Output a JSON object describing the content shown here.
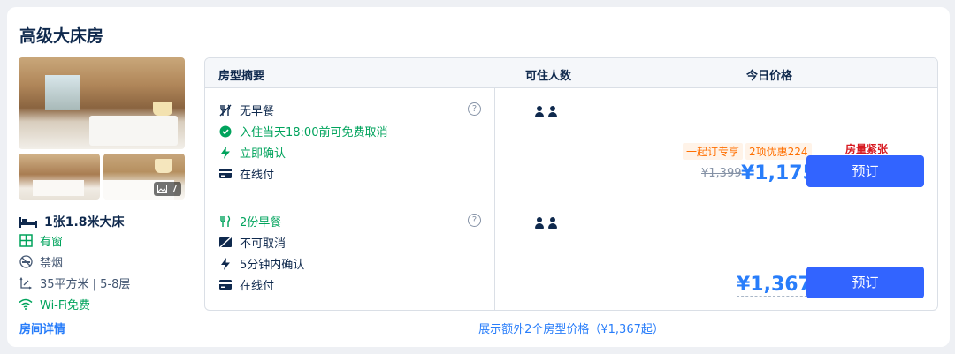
{
  "room": {
    "title": "高级大床房",
    "photo_count": "7",
    "bed": "1张1.8米大床",
    "features": [
      {
        "icon": "window-icon",
        "text": "有窗"
      },
      {
        "icon": "no-smoking-icon",
        "text": "禁烟"
      },
      {
        "icon": "area-icon",
        "text": "35平方米 | 5-8层"
      },
      {
        "icon": "wifi-icon",
        "text": "Wi-Fi免费"
      }
    ],
    "detail_link": "房间详情"
  },
  "table": {
    "headers": [
      "房型摘要",
      "可住人数",
      "今日价格"
    ],
    "rows": [
      {
        "policies": [
          {
            "icon": "no-breakfast-icon",
            "text": "无早餐",
            "color": "#0f294d"
          },
          {
            "icon": "check-circle-icon",
            "text": "入住当天18:00前可免费取消",
            "color": "#00a35c"
          },
          {
            "icon": "lightning-icon",
            "text": "立即确认",
            "color": "#00a35c"
          },
          {
            "icon": "card-icon",
            "text": "在线付",
            "color": "#0f294d"
          }
        ],
        "guests": 2,
        "urgent": "房量紧张",
        "promo": [
          "一起订专享",
          "2项优惠224"
        ],
        "old_price": "¥1,399",
        "price": "¥1,175",
        "button": "预订"
      },
      {
        "policies": [
          {
            "icon": "breakfast-icon",
            "text": "2份早餐",
            "color": "#00a35c"
          },
          {
            "icon": "no-cancel-icon",
            "text": "不可取消",
            "color": "#0f294d"
          },
          {
            "icon": "lightning-icon",
            "text": "5分钟内确认",
            "color": "#0f294d"
          },
          {
            "icon": "card-icon",
            "text": "在线付",
            "color": "#0f294d"
          }
        ],
        "guests": 2,
        "price": "¥1,367",
        "button": "预订"
      }
    ]
  },
  "more_prices": "展示额外2个房型价格（¥1,367起）",
  "colors": {
    "accent": "#287dfa",
    "button": "#3264ff",
    "green": "#00a35c",
    "urgent": "#d71920",
    "promo": "#ff6f00"
  }
}
